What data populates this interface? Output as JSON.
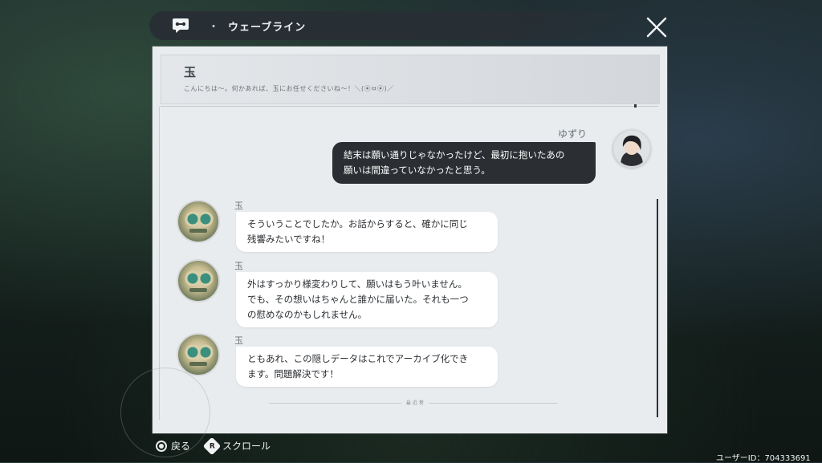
{
  "window": {
    "title": "ウェーブライン",
    "separator": "・",
    "icons": {
      "app": "chat-bubble-icon",
      "close": "close-x-icon"
    }
  },
  "chat": {
    "contact_name": "玉",
    "contact_status": "こんにちは〜。何かあれば、玉にお任せくださいね〜！＼(⦿ㅂ⦿)／",
    "end_marker": "最 近 巻",
    "messages": [
      {
        "sender": "ゆずり",
        "side": "right",
        "lines": [
          "結末は願い通りじゃなかったけど、最初に抱いたあの",
          "願いは間違っていなかったと思う。"
        ]
      },
      {
        "sender": "玉",
        "side": "left",
        "lines": [
          "そういうことでしたか。お話からすると、確かに同じ",
          "残響みたいですね！"
        ]
      },
      {
        "sender": "玉",
        "side": "left",
        "lines": [
          "外はすっかり様変わりして、願いはもう叶いません。",
          "でも、その想いはちゃんと誰かに届いた。それも一つ",
          "の慰めなのかもしれません。"
        ]
      },
      {
        "sender": "玉",
        "side": "left",
        "lines": [
          "ともあれ、この隠しデータはこれでアーカイブ化でき",
          "ます。問題解決です！"
        ]
      }
    ]
  },
  "footer": {
    "back_label": "戻る",
    "scroll_key": "R",
    "scroll_label": "スクロール",
    "user_id": "ユーザーID：704333691"
  },
  "colors": {
    "panel_bg": "#e9ecee",
    "self_bubble": "#2b2f33",
    "bot_bubble": "#ffffff"
  }
}
